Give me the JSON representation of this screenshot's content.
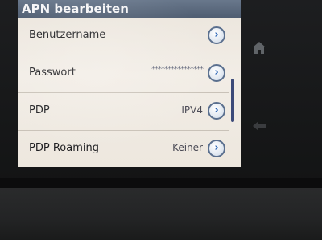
{
  "header": {
    "title": "APN bearbeiten"
  },
  "settings": [
    {
      "label": "Benutzername",
      "value": "",
      "chevron": "›"
    },
    {
      "label": "Passwort",
      "value": "****************",
      "chevron": "›"
    },
    {
      "label": "PDP",
      "value": "IPV4",
      "chevron": "›"
    },
    {
      "label": "PDP Roaming",
      "value": "Keiner",
      "chevron": "›"
    }
  ],
  "icons": {
    "home": "home-icon",
    "back": "back-icon",
    "row_action": "chevron-right-icon"
  },
  "colors": {
    "titlebar": "#5b6a80",
    "chevron": "#2e67b7",
    "scrollbar": "#3c4a79"
  }
}
